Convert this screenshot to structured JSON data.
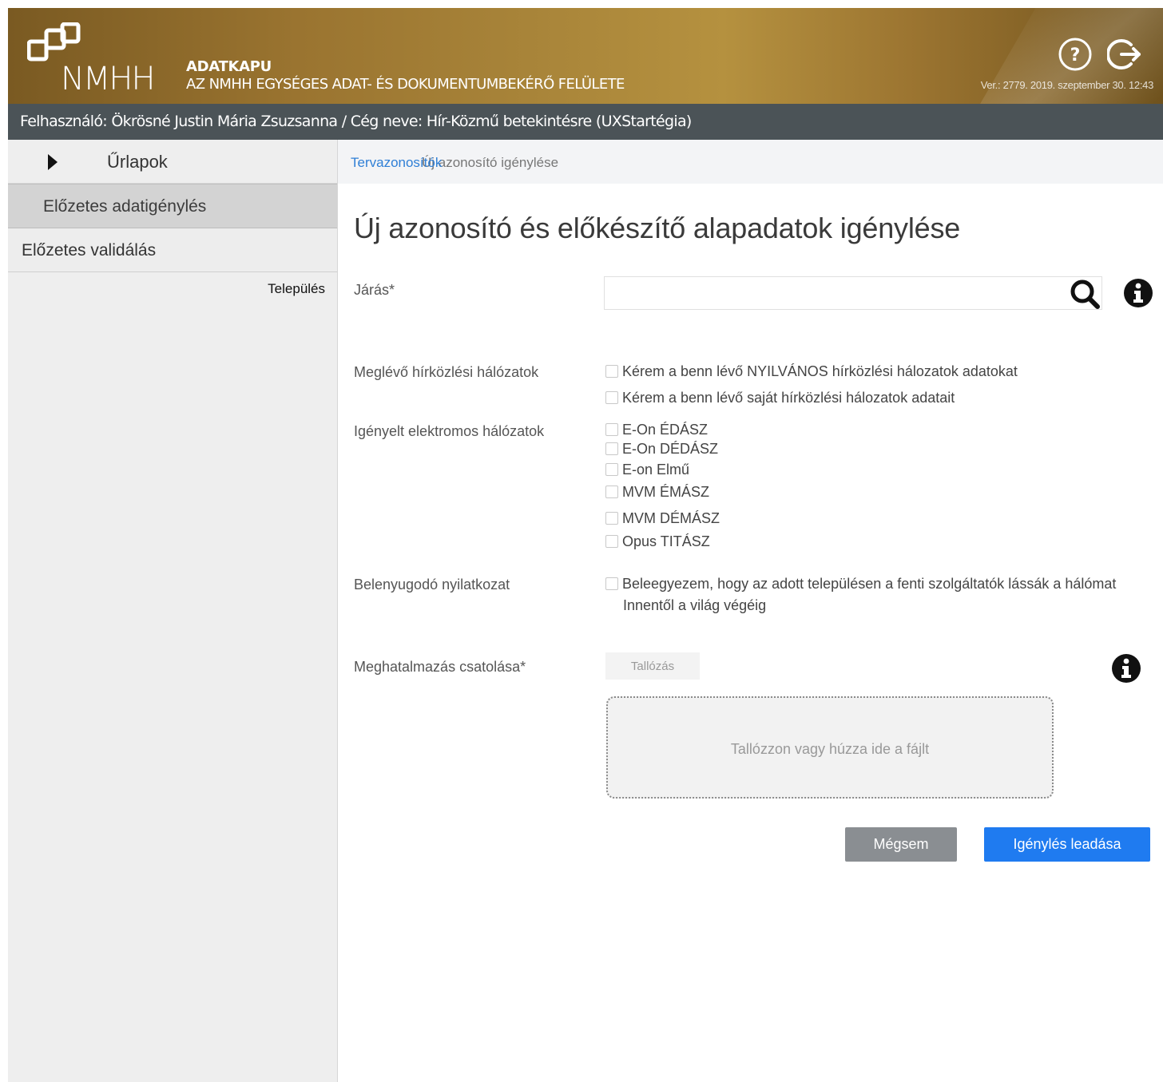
{
  "header": {
    "logo_text": "NMHH",
    "app_name": "ADATKAPU",
    "app_subtitle": "AZ NMHH EGYSÉGES ADAT- ÉS DOKUMENTUMBEKÉRŐ FELÜLETE",
    "version": "Ver.: 2779. 2019. szeptember 30. 12:43",
    "help_icon": "help-icon",
    "logout_icon": "logout-icon"
  },
  "userbar": {
    "text": "Felhasználó: Ökrösné Justin Mária Zsuzsanna / Cég neve: Hír-Közmű betekintésre (UXStartégia)"
  },
  "sidebar": {
    "top_label": "Űrlapok",
    "active_label": "Előzetes adatigénylés",
    "item_label": "Előzetes validálás",
    "note": "Település"
  },
  "breadcrumb": {
    "link": "Tervazonosítók",
    "current": "Új azonosító igénylése"
  },
  "form": {
    "title": "Új azonosító és előkészítő alapadatok igénylése",
    "jaras_label": "Járás*",
    "jaras_value": "",
    "networks_label": "Meglévő hírközlési hálózatok",
    "networks": [
      "Kérem a benn lévő NYILVÁNOS hírközlési hálozatok adatokat",
      "Kérem a benn lévő saját hírközlési hálozatok adatait"
    ],
    "electric_label": "Igényelt elektromos hálózatok",
    "electric": [
      "E-On ÉDÁSZ",
      "E-On DÉDÁSZ",
      "E-on Elmű",
      "MVM ÉMÁSZ",
      "MVM DÉMÁSZ",
      "Opus TITÁSZ"
    ],
    "consent_label": "Belenyugodó nyilatkozat",
    "consent_text": "Beleegyezem, hogy az adott településen a fenti szolgáltatók lássák a hálómat",
    "consent_text_cont": "Innentől a világ végéig",
    "attach_label": "Meghatalmazás csatolása*",
    "browse_label": "Tallózás",
    "dropzone_text": "Tallózzon vagy húzza ide a fájlt",
    "cancel_label": "Mégsem",
    "submit_label": "Igénylés leadása"
  },
  "colors": {
    "header_gold": "#9a7430",
    "userbar": "#4b5357",
    "primary": "#1f7bf0",
    "secondary": "#8a8e92",
    "link": "#2f7fd6"
  }
}
